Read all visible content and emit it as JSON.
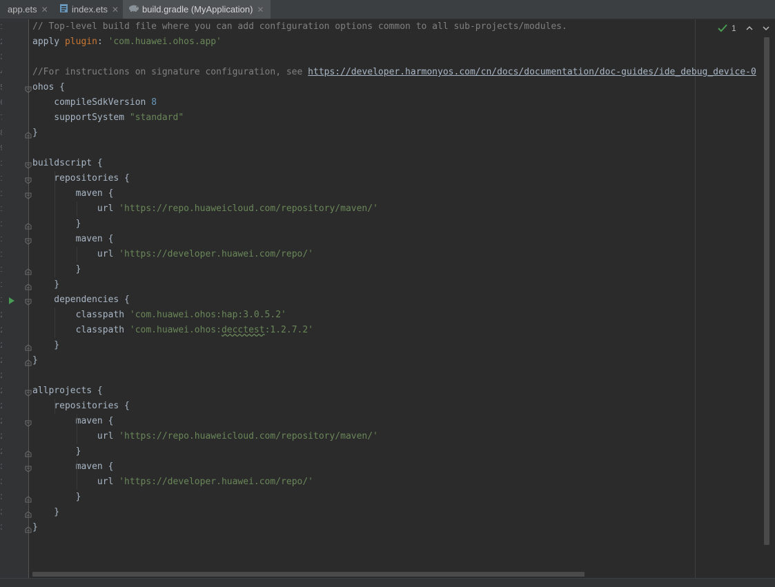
{
  "tabs": [
    {
      "label": "app.ets",
      "icon": "ets-file-icon",
      "active": false
    },
    {
      "label": "index.ets",
      "icon": "ets-file-icon",
      "active": false
    },
    {
      "label": "build.gradle (MyApplication)",
      "icon": "gradle-elephant-icon",
      "active": true
    }
  ],
  "tab_close_glyph": "✕",
  "inspection": {
    "count": "1",
    "icon": "inspection-ok-icon"
  },
  "code_lines": [
    "// Top-level build file where you can add configuration options common to all sub-projects/modules.",
    "apply plugin: 'com.huawei.ohos.app'",
    "",
    "//For instructions on signature configuration, see https://developer.harmonyos.com/cn/docs/documentation/doc-guides/ide_debug_device-0",
    "ohos {",
    "    compileSdkVersion 8",
    "    supportSystem \"standard\"",
    "}",
    "",
    "buildscript {",
    "    repositories {",
    "        maven {",
    "            url 'https://repo.huaweicloud.com/repository/maven/'",
    "        }",
    "        maven {",
    "            url 'https://developer.huawei.com/repo/'",
    "        }",
    "    }",
    "    dependencies {",
    "        classpath 'com.huawei.ohos:hap:3.0.5.2'",
    "        classpath 'com.huawei.ohos:decctest:1.2.7.2'",
    "    }",
    "}",
    "",
    "allprojects {",
    "    repositories {",
    "        maven {",
    "            url 'https://repo.huaweicloud.com/repository/maven/'",
    "        }",
    "        maven {",
    "            url 'https://developer.huawei.com/repo/'",
    "        }",
    "    }",
    "}"
  ],
  "line_numbers": [
    "1",
    "2",
    "3",
    "4",
    "5",
    "6",
    "7",
    "8",
    "9",
    "10",
    "11",
    "12",
    "13",
    "14",
    "15",
    "16",
    "17",
    "18",
    "19",
    "20",
    "21",
    "22",
    "23",
    "24",
    "25",
    "26",
    "27",
    "28",
    "29",
    "30",
    "31",
    "32",
    "33",
    "34",
    "35"
  ],
  "colors": {
    "background": "#2b2b2b",
    "gutter": "#313335",
    "default_text": "#a9b7c6",
    "comment": "#808080",
    "string": "#6a8759",
    "number": "#6897bb",
    "run_icon": "#499c54"
  },
  "run_gutter_line": "19"
}
